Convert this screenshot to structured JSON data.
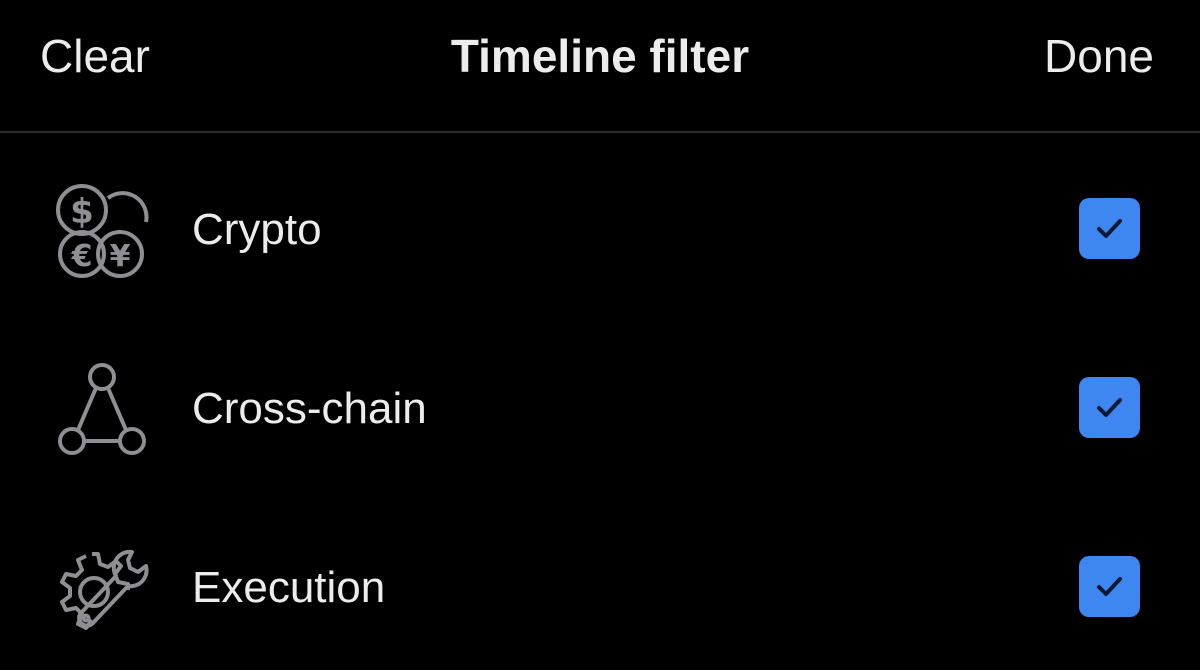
{
  "header": {
    "clear_label": "Clear",
    "title": "Timeline filter",
    "done_label": "Done"
  },
  "filters": [
    {
      "label": "Crypto",
      "icon": "currency-coins-icon",
      "checked": true
    },
    {
      "label": "Cross-chain",
      "icon": "triangle-network-icon",
      "checked": true
    },
    {
      "label": "Execution",
      "icon": "gear-wrench-icon",
      "checked": true
    }
  ],
  "colors": {
    "background": "#000000",
    "text": "#ececec",
    "icon": "#8e8e93",
    "checkbox": "#3e86f0",
    "checkmark": "#0b1a33",
    "divider": "#2c2c2e"
  }
}
